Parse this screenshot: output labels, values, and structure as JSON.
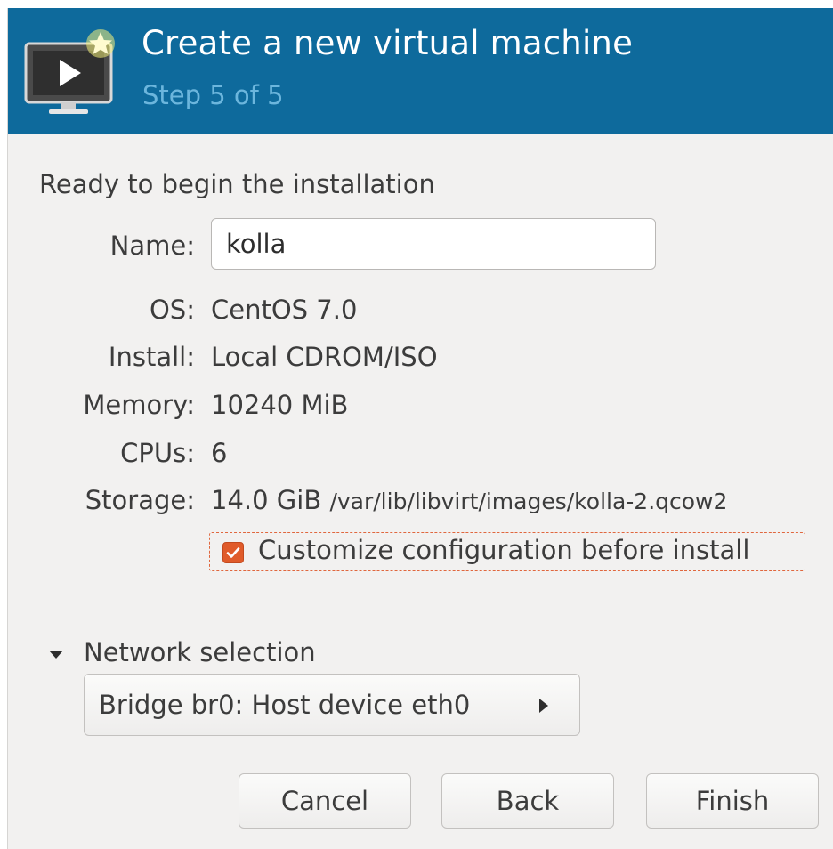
{
  "header": {
    "title": "Create a new virtual machine",
    "subtitle": "Step 5 of 5",
    "icon": "monitor-play-star-icon"
  },
  "summary": {
    "heading": "Ready to begin the installation",
    "name_label": "Name:",
    "name_value": "kolla",
    "os_label": "OS:",
    "os_value": "CentOS 7.0",
    "install_label": "Install:",
    "install_value": "Local CDROM/ISO",
    "memory_label": "Memory:",
    "memory_value": "10240 MiB",
    "cpus_label": "CPUs:",
    "cpus_value": "6",
    "storage_label": "Storage:",
    "storage_size": "14.0 GiB",
    "storage_path": "/var/lib/libvirt/images/kolla-2.qcow2"
  },
  "customize": {
    "label": "Customize configuration before install",
    "checked": true
  },
  "network": {
    "expander_label": "Network selection",
    "expanded": true,
    "selected": "Bridge br0: Host device eth0"
  },
  "buttons": {
    "cancel": "Cancel",
    "back": "Back",
    "finish": "Finish"
  },
  "colors": {
    "header_bg": "#0e6a9c",
    "subtitle": "#6cb6dd",
    "checkbox_accent": "#e05b2a",
    "window_bg": "#f2f1f0"
  }
}
